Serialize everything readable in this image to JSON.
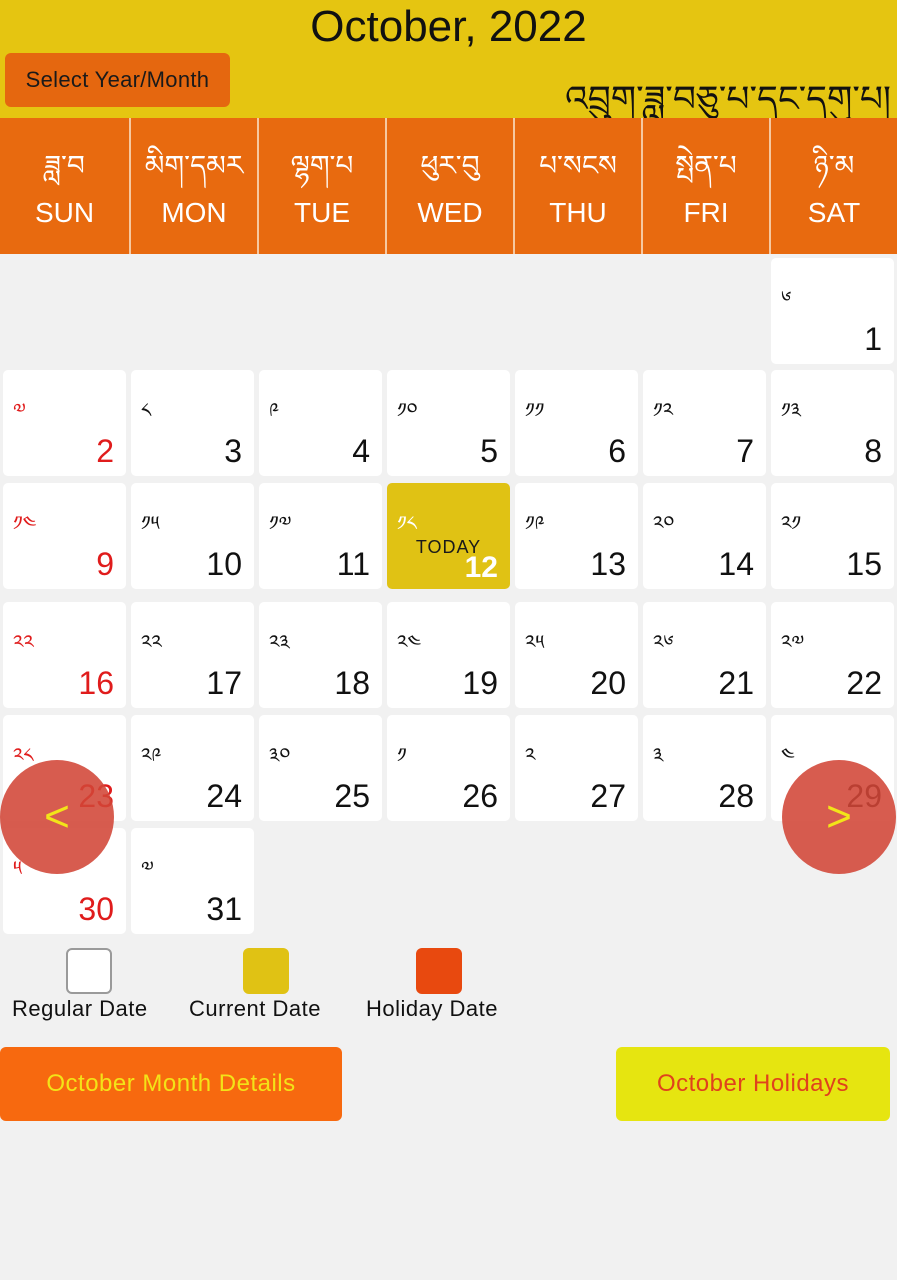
{
  "header": {
    "month_title": "October, 2022",
    "select_label": "Select Year/Month",
    "tibetan_title": "འབྲུག་ཟླ་བཅུ་པ་དང་དགུ་པ།",
    "bg_color": "#e5c511"
  },
  "weekdays": [
    {
      "tib": "ཟླ་བ",
      "en": "SUN"
    },
    {
      "tib": "མིག་དམར",
      "en": "MON"
    },
    {
      "tib": "ལྷག་པ",
      "en": "TUE"
    },
    {
      "tib": "ཕུར་བུ",
      "en": "WED"
    },
    {
      "tib": "པ་སངས",
      "en": "THU"
    },
    {
      "tib": "སྤེན་པ",
      "en": "FRI"
    },
    {
      "tib": "ཉི་མ",
      "en": "SAT"
    }
  ],
  "days": [
    {
      "tib": "༦",
      "num": "1"
    },
    {
      "tib": "༧",
      "num": "2"
    },
    {
      "tib": "༨",
      "num": "3"
    },
    {
      "tib": "༩",
      "num": "4"
    },
    {
      "tib": "༡༠",
      "num": "5"
    },
    {
      "tib": "༡༡",
      "num": "6"
    },
    {
      "tib": "༡༢",
      "num": "7"
    },
    {
      "tib": "༡༣",
      "num": "8"
    },
    {
      "tib": "༡༤",
      "num": "9"
    },
    {
      "tib": "༡༥",
      "num": "10"
    },
    {
      "tib": "༡༧",
      "num": "11"
    },
    {
      "tib": "༡༨",
      "num": "12"
    },
    {
      "tib": "༡༩",
      "num": "13"
    },
    {
      "tib": "༢༠",
      "num": "14"
    },
    {
      "tib": "༢༡",
      "num": "15"
    },
    {
      "tib": "༢༢",
      "num": "16"
    },
    {
      "tib": "༢༢",
      "num": "17"
    },
    {
      "tib": "༢༣",
      "num": "18"
    },
    {
      "tib": "༢༤",
      "num": "19"
    },
    {
      "tib": "༢༥",
      "num": "20"
    },
    {
      "tib": "༢༦",
      "num": "21"
    },
    {
      "tib": "༢༧",
      "num": "22"
    },
    {
      "tib": "༢༨",
      "num": "23"
    },
    {
      "tib": "༢༩",
      "num": "24"
    },
    {
      "tib": "༣༠",
      "num": "25"
    },
    {
      "tib": "༡",
      "num": "26"
    },
    {
      "tib": "༢",
      "num": "27"
    },
    {
      "tib": "༣",
      "num": "28"
    },
    {
      "tib": "༤",
      "num": "29"
    },
    {
      "tib": "༥",
      "num": "30"
    },
    {
      "tib": "༧",
      "num": "31"
    }
  ],
  "today_label": "TODAY",
  "nav": {
    "prev": "<",
    "next": ">"
  },
  "legend": {
    "regular": "Regular Date",
    "current": "Current Date",
    "holiday": "Holiday Date"
  },
  "buttons": {
    "month_details": "October Month Details",
    "holidays": "October Holidays"
  },
  "colors": {
    "header": "#e5c511",
    "weekday_bar": "#e86a0f",
    "today": "#e0c214",
    "holiday_legend": "#e8490f",
    "holiday_text": "#e01c1c",
    "nav_button": "#d24637",
    "month_details_button": "#f7690f",
    "holidays_button": "#e6e510"
  }
}
